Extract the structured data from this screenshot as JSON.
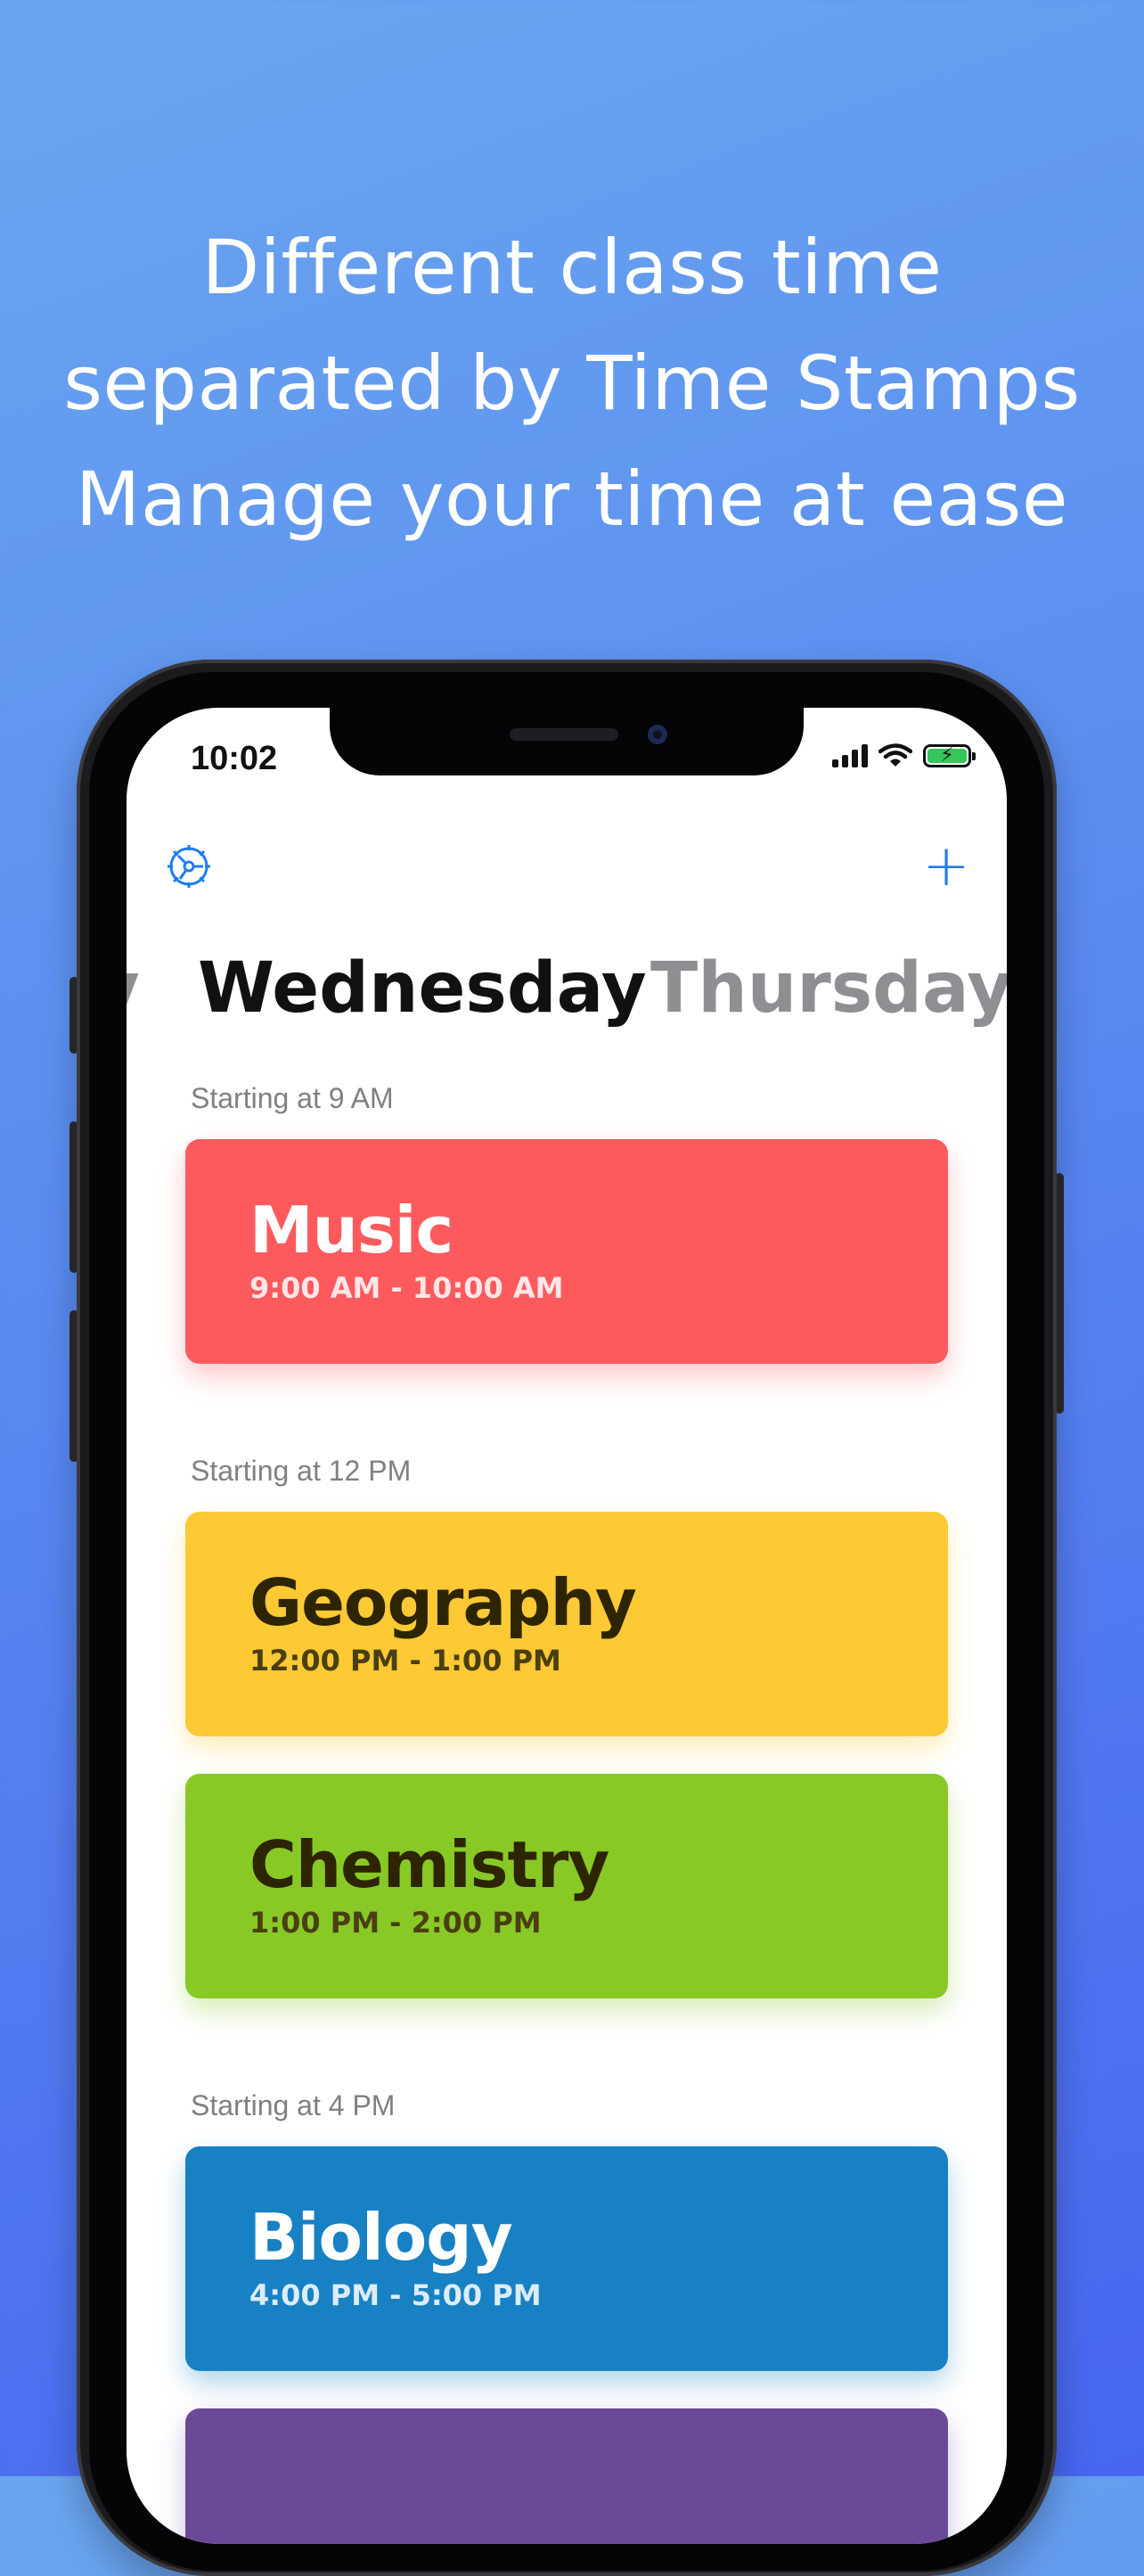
{
  "headline": {
    "line1": "Different class time",
    "line2": "separated by Time Stamps",
    "line3": "Manage your time at ease"
  },
  "status_bar": {
    "time": "10:02",
    "icons": [
      "cellular-signal-icon",
      "wifi-icon",
      "battery-charging-icon"
    ]
  },
  "toolbar": {
    "settings_icon": "gear-icon",
    "add_icon": "plus-icon",
    "add_label": "+"
  },
  "day_picker": {
    "previous": "y",
    "current": "Wednesday",
    "next": "Thursday"
  },
  "sections": [
    {
      "label": "Starting at 9 AM",
      "classes": [
        {
          "name": "Music",
          "time": "9:00 AM - 10:00 AM",
          "color": "#fd5a5d"
        }
      ]
    },
    {
      "label": "Starting at 12 PM",
      "classes": [
        {
          "name": "Geography",
          "time": "12:00 PM - 1:00 PM",
          "color": "#fdc934"
        },
        {
          "name": "Chemistry",
          "time": "1:00 PM - 2:00 PM",
          "color": "#88c926"
        }
      ]
    },
    {
      "label": "Starting at 4 PM",
      "classes": [
        {
          "name": "Biology",
          "time": "4:00 PM - 5:00 PM",
          "color": "#1781c3"
        },
        {
          "name": "",
          "time": "",
          "color": "#6a4a98"
        }
      ]
    }
  ],
  "colors": {
    "accent": "#1e7cf2",
    "background_top": "#6aa6ef",
    "background_bottom": "#4666f0"
  }
}
